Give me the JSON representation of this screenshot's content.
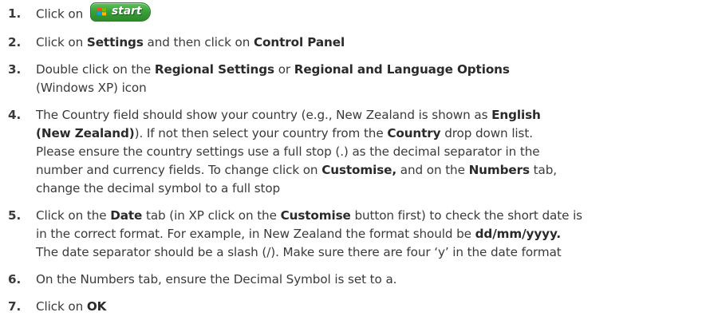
{
  "steps": [
    {
      "num": "1.",
      "parts": [
        {
          "t": "Click on "
        }
      ],
      "start_button": {
        "label": "start",
        "icon": "windows-flag-icon"
      }
    },
    {
      "num": "2.",
      "parts": [
        {
          "t": "Click on "
        },
        {
          "b": "Settings"
        },
        {
          "t": " and then click on "
        },
        {
          "b": "Control Panel"
        }
      ]
    },
    {
      "num": "3.",
      "parts": [
        {
          "t": "Double click on the "
        },
        {
          "b": "Regional Settings"
        },
        {
          "t": " or "
        },
        {
          "b": "Regional and Language Options"
        },
        {
          "br": true
        },
        {
          "t": "(Windows XP) icon"
        }
      ]
    },
    {
      "num": "4.",
      "parts": [
        {
          "t": "The Country field should show your country (e.g., New Zealand is shown as "
        },
        {
          "b": "English"
        },
        {
          "br": true
        },
        {
          "b": "(New Zealand)"
        },
        {
          "t": "). If not then select your country from the "
        },
        {
          "b": "Country"
        },
        {
          "t": " drop down list."
        },
        {
          "br": true
        },
        {
          "t": "Please ensure the country settings use a full stop (.) as the decimal separator in the"
        },
        {
          "br": true
        },
        {
          "t": "number and currency fields. To change click on "
        },
        {
          "b": "Customise,"
        },
        {
          "t": " and on the "
        },
        {
          "b": "Numbers"
        },
        {
          "t": " tab,"
        },
        {
          "br": true
        },
        {
          "t": "change the decimal symbol to a full stop"
        }
      ]
    },
    {
      "num": "5.",
      "parts": [
        {
          "t": "Click on the "
        },
        {
          "b": "Date"
        },
        {
          "t": " tab (in XP click on the "
        },
        {
          "b": "Customise"
        },
        {
          "t": " button first) to check the short date is"
        },
        {
          "br": true
        },
        {
          "t": "in the correct format. For example, in New Zealand the format should be "
        },
        {
          "b": "dd/mm/yyyy."
        },
        {
          "br": true
        },
        {
          "t": "The date separator should be a slash (/). Make sure there are four ‘y’ in the date format"
        }
      ]
    },
    {
      "num": "6.",
      "parts": [
        {
          "t": "On the Numbers tab, ensure the Decimal Symbol is set to a."
        }
      ]
    },
    {
      "num": "7.",
      "parts": [
        {
          "t": "Click on "
        },
        {
          "b": "OK"
        }
      ]
    }
  ]
}
